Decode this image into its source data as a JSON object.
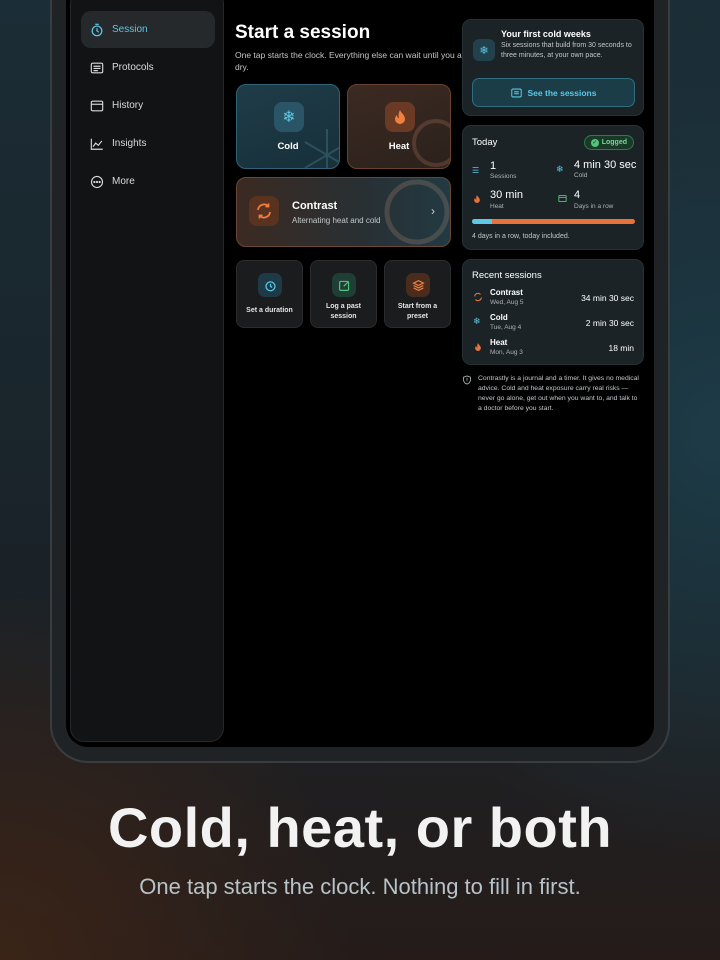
{
  "sidebar": {
    "items": [
      {
        "label": "Session",
        "icon": "timer-icon",
        "active": true
      },
      {
        "label": "Protocols",
        "icon": "list-icon"
      },
      {
        "label": "History",
        "icon": "calendar-icon"
      },
      {
        "label": "Insights",
        "icon": "chart-icon"
      },
      {
        "label": "More",
        "icon": "more-icon"
      }
    ]
  },
  "main": {
    "title": "Start a session",
    "subtitle": "One tap starts the clock. Everything else can wait until you are dry.",
    "cold_label": "Cold",
    "heat_label": "Heat",
    "contrast_label": "Contrast",
    "contrast_sub": "Alternating heat and cold",
    "actions": [
      {
        "label": "Set a duration",
        "icon": "timer-icon"
      },
      {
        "label": "Log a past session",
        "icon": "edit-icon"
      },
      {
        "label": "Start from a preset",
        "icon": "layers-icon"
      }
    ]
  },
  "promo": {
    "title": "Your first cold weeks",
    "body": "Six sessions that build from 30 seconds to three minutes, at your own pace.",
    "button": "See the sessions"
  },
  "today": {
    "title": "Today",
    "badge": "Logged",
    "stats": [
      {
        "value": "1",
        "label": "Sessions"
      },
      {
        "value": "4 min 30 sec",
        "label": "Cold"
      },
      {
        "value": "30 min",
        "label": "Heat"
      },
      {
        "value": "4",
        "label": "Days in a row"
      }
    ],
    "progress_cold_fraction": 0.12,
    "streak_text": "4 days in a row, today included."
  },
  "recent": {
    "title": "Recent sessions",
    "rows": [
      {
        "type": "Contrast",
        "date": "Wed, Aug 5",
        "duration": "34 min 30 sec"
      },
      {
        "type": "Cold",
        "date": "Tue, Aug 4",
        "duration": "2 min 30 sec"
      },
      {
        "type": "Heat",
        "date": "Mon, Aug 3",
        "duration": "18 min"
      }
    ]
  },
  "disclaimer": "Contrastly is a journal and a timer. It gives no medical advice. Cold and heat exposure carry real risks — never go alone, get out when you want to, and talk to a doctor before you start.",
  "marketing": {
    "headline": "Cold, heat, or both",
    "subline": "One tap starts the clock. Nothing to fill in first."
  },
  "colors": {
    "cold": "#5cc8e6",
    "heat": "#e8733a",
    "logged": "#52c47a"
  }
}
